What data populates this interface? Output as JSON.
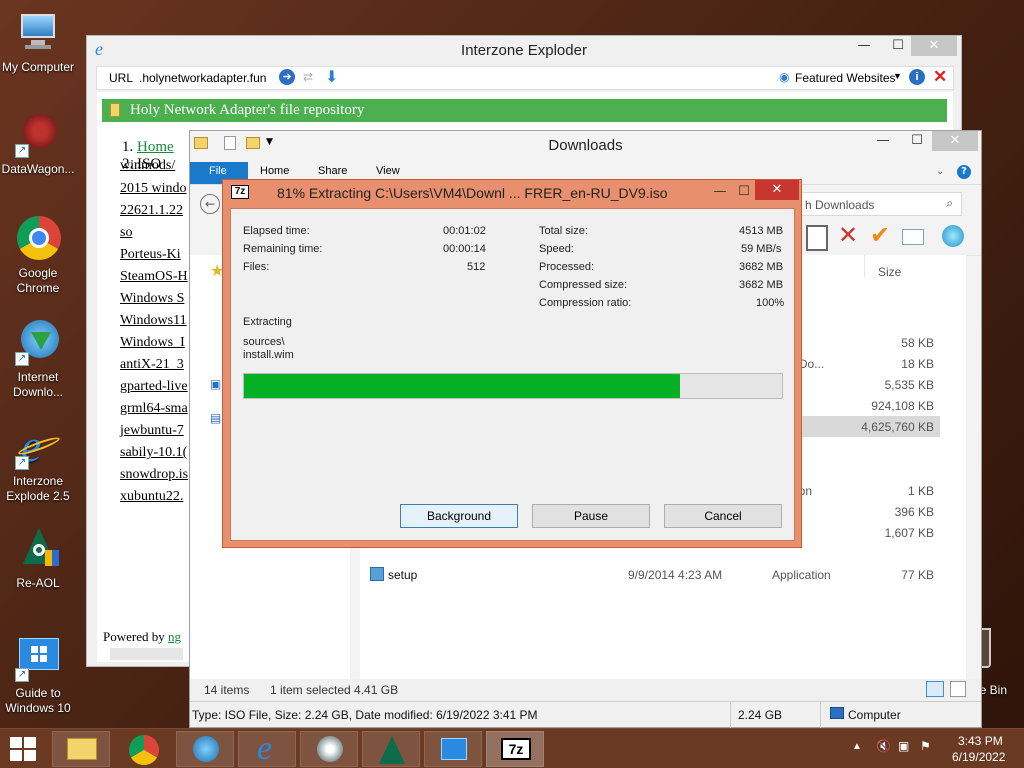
{
  "desktop": {
    "icons": [
      {
        "label": "My Computer",
        "icon": "computer-icon"
      },
      {
        "label": "DataWagon...",
        "icon": "datawagon-icon"
      },
      {
        "label": "Google Chrome",
        "icon": "chrome-icon"
      },
      {
        "label": "Internet Downlo...",
        "icon": "idm-icon"
      },
      {
        "label": "Interzone Explode\r 2.5",
        "icon": "ie-icon"
      },
      {
        "label": "Re-AOL",
        "icon": "reaol-icon"
      },
      {
        "label": "Guide to Windows 10",
        "icon": "windows-icon"
      }
    ],
    "recycle_label": "e Bin"
  },
  "browser": {
    "title": "Interzone Exploder",
    "url_label": "URL",
    "url": ".holynetworkadapter.fun",
    "featured": "Featured Websites",
    "banner": "Holy Network Adapter's file repository",
    "breadcrumb": [
      "1. Home",
      "2. ISO"
    ],
    "links": [
      "winmods/",
      "2015 windo",
      "22621.1.22",
      "so",
      "Porteus-Ki",
      "SteamOS-H",
      "Windows S",
      "Windows11",
      "Windows_I",
      "antiX-21_3",
      "gparted-live",
      "grml64-sma",
      "jewbuntu-7",
      "sabily-10.1(",
      "snowdrop.is",
      "xubuntu22."
    ],
    "powered_by": "Powered by",
    "powered_link": "ng"
  },
  "explorer": {
    "title": "Downloads",
    "tabs": [
      "File",
      "Home",
      "Share",
      "View"
    ],
    "search_placeholder": "h Downloads",
    "col_size": "Size",
    "rows": [
      {
        "name": "",
        "date": "",
        "type": "",
        "size": "58 KB"
      },
      {
        "name": "",
        "date": "",
        "type": "TML Do...",
        "size": "18 KB"
      },
      {
        "name": "",
        "date": "",
        "type": "n",
        "size": "5,535 KB"
      },
      {
        "name": "",
        "date": "",
        "type": "",
        "size": "924,108 KB"
      },
      {
        "name": "",
        "date": "",
        "type": "",
        "size": "4,625,760 KB"
      },
      {
        "name": "",
        "date": "",
        "type": "rmation",
        "size": "1 KB"
      },
      {
        "name": "",
        "date": "",
        "type": "",
        "size": "396 KB"
      },
      {
        "name": "",
        "date": "",
        "type": "",
        "size": "1,607 KB"
      },
      {
        "name": "setup",
        "date": "9/9/2014 4:23 AM",
        "type": "Application",
        "size": "77 KB"
      }
    ],
    "status_items": "14 items",
    "status_selected": "1 item selected  4.41 GB",
    "info_type": "Type: ISO File, Size: 2.24 GB, Date modified: 6/19/2022 3:41 PM",
    "info_size": "2.24 GB",
    "info_location": "Computer"
  },
  "sevenzip": {
    "logo": "7z",
    "title": "81% Extracting C:\\Users\\VM4\\Downl ... FRER_en-RU_DV9.iso",
    "elapsed_label": "Elapsed time:",
    "elapsed": "00:01:02",
    "remaining_label": "Remaining time:",
    "remaining": "00:00:14",
    "files_label": "Files:",
    "files": "512",
    "total_label": "Total size:",
    "total": "4513 MB",
    "speed_label": "Speed:",
    "speed": "59 MB/s",
    "processed_label": "Processed:",
    "processed": "3682 MB",
    "compressed_label": "Compressed size:",
    "compressed": "3682 MB",
    "ratio_label": "Compression ratio:",
    "ratio": "100%",
    "extracting_label": "Extracting",
    "path1": "sources\\",
    "path2": "install.wim",
    "progress": 0.81,
    "btn_background": "Background",
    "btn_pause": "Pause",
    "btn_cancel": "Cancel"
  },
  "taskbar": {
    "time": "3:43 PM",
    "date": "6/19/2022",
    "pinned": [
      "explorer-icon",
      "chrome-icon",
      "idm-icon",
      "ie-icon",
      "media-icon",
      "reaol-icon",
      "windows-icon",
      "sevenzip-icon"
    ]
  },
  "colors": {
    "green": "#4caf50",
    "progress": "#06b025",
    "zip_frame": "#e88f6e",
    "accent": "#1979ca"
  }
}
